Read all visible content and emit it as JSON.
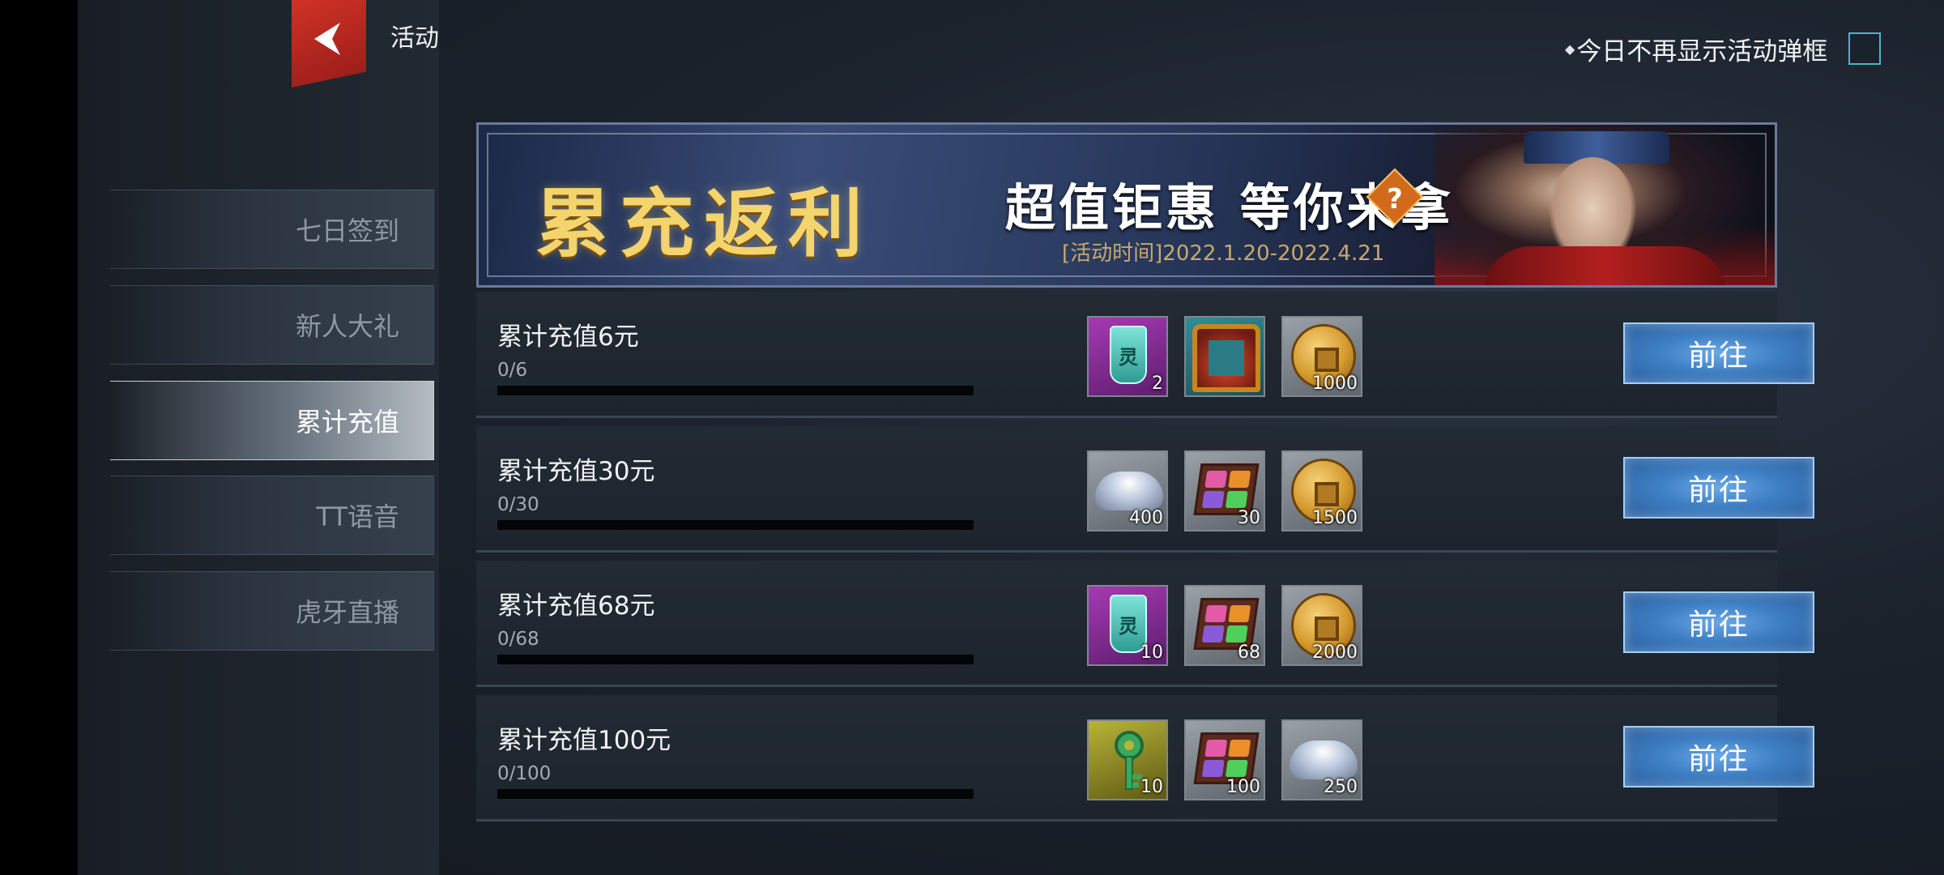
{
  "header": {
    "title": "活动",
    "dont_show_label": "今日不再显示活动弹框",
    "dont_show_checked": false
  },
  "sidebar": {
    "items": [
      {
        "label": "七日签到",
        "active": false
      },
      {
        "label": "新人大礼",
        "active": false
      },
      {
        "label": "累计充值",
        "active": true
      },
      {
        "label": "TT语音",
        "active": false
      },
      {
        "label": "虎牙直播",
        "active": false
      }
    ]
  },
  "banner": {
    "title": "累充返利",
    "slogan": "超值钜惠 等你来拿",
    "date": "[活动时间]2022.1.20-2022.4.21"
  },
  "rewards": [
    {
      "title": "累计充值6元",
      "progress_text": "0/6",
      "progress": 0,
      "items": [
        {
          "icon": "token-icon",
          "count": "2"
        },
        {
          "icon": "avatar-frame-icon",
          "count": ""
        },
        {
          "icon": "coin-icon",
          "count": "1000"
        }
      ],
      "button": "前往"
    },
    {
      "title": "累计充值30元",
      "progress_text": "0/30",
      "progress": 0,
      "items": [
        {
          "icon": "silver-ingot-icon",
          "count": "400"
        },
        {
          "icon": "gem-box-icon",
          "count": "30"
        },
        {
          "icon": "coin-icon",
          "count": "1500"
        }
      ],
      "button": "前往"
    },
    {
      "title": "累计充值68元",
      "progress_text": "0/68",
      "progress": 0,
      "items": [
        {
          "icon": "token-icon",
          "count": "10"
        },
        {
          "icon": "gem-box-icon",
          "count": "68"
        },
        {
          "icon": "coin-icon",
          "count": "2000"
        }
      ],
      "button": "前往"
    },
    {
      "title": "累计充值100元",
      "progress_text": "0/100",
      "progress": 0,
      "items": [
        {
          "icon": "key-icon",
          "count": "10"
        },
        {
          "icon": "gem-box-icon",
          "count": "100"
        },
        {
          "icon": "silver-ingot-icon",
          "count": "250"
        }
      ],
      "button": "前往"
    }
  ]
}
